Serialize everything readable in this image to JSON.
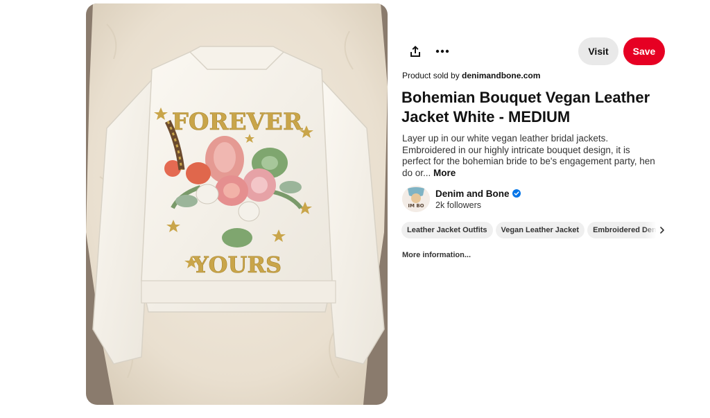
{
  "pin": {
    "image_alt": "White vegan leather jacket with embroidered FOREVER YOURS bouquet design",
    "embroidery_top": "FOREVER",
    "embroidery_bottom": "YOURS"
  },
  "actions": {
    "share_icon": "share-icon",
    "more_icon": "more-options-icon",
    "visit_label": "Visit",
    "save_label": "Save"
  },
  "product": {
    "sold_by_prefix": "Product sold by ",
    "sold_by_domain": "denimandbone.com",
    "title": "Bohemian Bouquet Vegan Leather Jacket White - MEDIUM",
    "description": "Layer up in our white vegan leather bridal jackets. Embroidered in our highly intricate bouquet design, it is perfect for the bohemian bride to be's engagement party, hen do or... ",
    "more_label": "More"
  },
  "creator": {
    "name": "Denim and Bone",
    "followers": "2k followers",
    "verified_icon": "verified-badge-icon",
    "avatar_text": "IM BO"
  },
  "tags": [
    "Leather Jacket Outfits",
    "Vegan Leather Jacket",
    "Embroidered Denim"
  ],
  "tags_next_icon": "chevron-right-icon",
  "more_information_label": "More information...",
  "colors": {
    "save_red": "#e60023",
    "visit_gray": "#e9e9e9",
    "verified_blue": "#0074e8",
    "tag_gray": "#efefef"
  }
}
